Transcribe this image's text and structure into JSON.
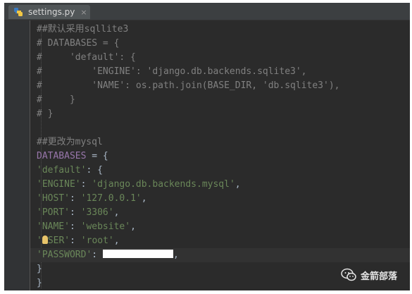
{
  "tab": {
    "label": "settings.py",
    "close": "×"
  },
  "code": {
    "l1": "##默认采用sqllite3",
    "l2": "# DATABASES = {",
    "l3": "#     'default': {",
    "l4": "#         'ENGINE': 'django.db.backends.sqlite3',",
    "l5": "#         'NAME': os.path.join(BASE_DIR, 'db.sqlite3'),",
    "l6": "#     }",
    "l7": "# }",
    "l9": "##更改为mysql",
    "l10_var": "DATABASES",
    "l10_op": " = {",
    "l11_key": "'default'",
    "l11_rest": ": {",
    "l12_key": "'ENGINE'",
    "l12_sep": ": ",
    "l12_val": "'django.db.backends.mysql'",
    "l12_end": ",",
    "l13_key": "'HOST'",
    "l13_sep": ": ",
    "l13_val": "'127.0.0.1'",
    "l13_end": ",",
    "l14_key": "'PORT'",
    "l14_sep": ": ",
    "l14_val": "'3306'",
    "l14_end": ",",
    "l15_key": "'NAME'",
    "l15_sep": ": ",
    "l15_val": "'website'",
    "l15_end": ",",
    "l16_key": "'SER'",
    "l16_key_prefix": "'",
    "l16_sep": ": ",
    "l16_val": "'root'",
    "l16_end": ",",
    "l17_key": "'PASSWORD'",
    "l17_sep": ": ",
    "l17_end": ",",
    "l18": "}",
    "l19": "}"
  },
  "watermark": {
    "text": "金箭部落"
  },
  "colors": {
    "background": "#2b2b2b",
    "comment": "#808080",
    "string": "#6a8759",
    "variable": "#9876aa",
    "default_text": "#a9b7c6"
  }
}
